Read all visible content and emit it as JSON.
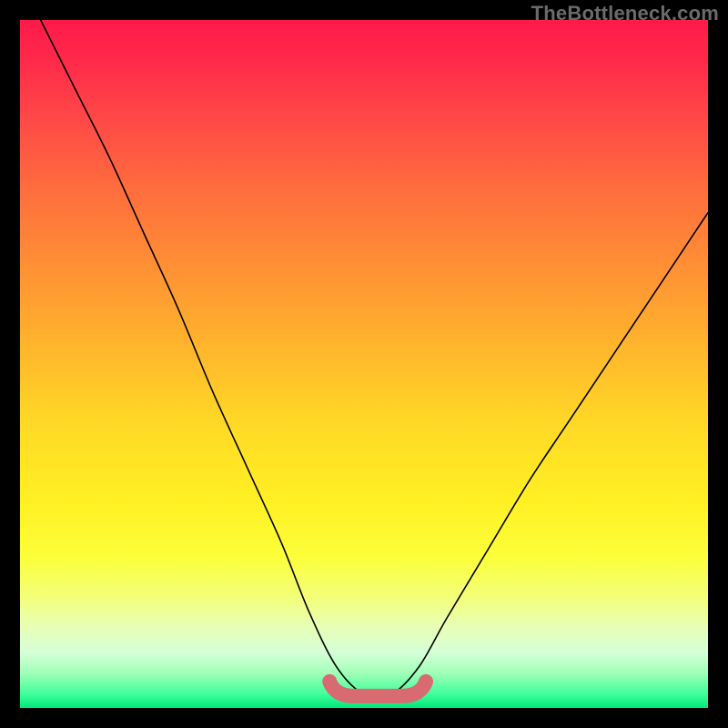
{
  "watermark": "TheBottleneck.com",
  "colors": {
    "background": "#000000",
    "curve_stroke": "#000000",
    "flat_highlight": "#d86a72"
  },
  "chart_data": {
    "type": "line",
    "title": "",
    "xlabel": "",
    "ylabel": "",
    "xlim": [
      0,
      100
    ],
    "ylim": [
      0,
      100
    ],
    "grid": false,
    "series": [
      {
        "name": "bottleneck-curve",
        "x": [
          3,
          8,
          13,
          18,
          23,
          28,
          33,
          38,
          42,
          46,
          50,
          54,
          58,
          62,
          68,
          74,
          80,
          86,
          92,
          100
        ],
        "y": [
          100,
          90,
          80,
          69,
          58,
          46,
          35,
          24,
          14,
          6,
          2,
          2,
          6,
          13,
          23,
          33,
          42,
          51,
          60,
          72
        ]
      }
    ],
    "annotations": [
      {
        "name": "flat-bottom-highlight",
        "x_range": [
          45,
          59
        ],
        "y": 2,
        "style": "thick-pink"
      }
    ]
  }
}
